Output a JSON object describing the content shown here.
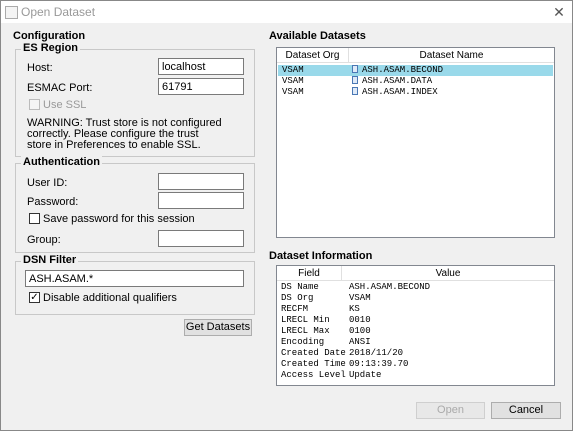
{
  "window": {
    "title": "Open Dataset",
    "close_symbol": "✕"
  },
  "configuration": {
    "title": "Configuration",
    "es_region": {
      "legend": "ES Region",
      "host_label": "Host:",
      "host_value": "localhost",
      "port_label": "ESMAC Port:",
      "port_value": "61791",
      "use_ssl_label": "Use SSL",
      "warning_line1": "WARNING: Trust store is not configured",
      "warning_line2": "correctly. Please configure the trust",
      "warning_line3": "store in Preferences to enable SSL."
    },
    "authentication": {
      "legend": "Authentication",
      "user_label": "User ID:",
      "password_label": "Password:",
      "save_password_label": "Save password for this session",
      "group_label": "Group:"
    },
    "dsn_filter": {
      "legend": "DSN Filter",
      "value": "ASH.ASAM.*",
      "disable_qualifiers_label": "Disable additional qualifiers",
      "disable_qualifiers_checked": "✓"
    },
    "get_datasets_label": "Get Datasets"
  },
  "available_datasets": {
    "title": "Available Datasets",
    "columns": [
      "Dataset Org",
      "Dataset Name"
    ],
    "rows": [
      {
        "org": "VSAM",
        "name": "ASH.ASAM.BECOND",
        "selected": true
      },
      {
        "org": "VSAM",
        "name": "ASH.ASAM.DATA",
        "selected": false
      },
      {
        "org": "VSAM",
        "name": "ASH.ASAM.INDEX",
        "selected": false
      }
    ]
  },
  "dataset_information": {
    "title": "Dataset Information",
    "columns": [
      "Field",
      "Value"
    ],
    "rows": [
      {
        "field": "DS Name",
        "value": "ASH.ASAM.BECOND"
      },
      {
        "field": "DS Org",
        "value": "VSAM"
      },
      {
        "field": "RECFM",
        "value": "KS"
      },
      {
        "field": "LRECL Min",
        "value": "0010"
      },
      {
        "field": "LRECL Max",
        "value": "0100"
      },
      {
        "field": "Encoding",
        "value": "ANSI"
      },
      {
        "field": "Created Date",
        "value": "2018/11/20"
      },
      {
        "field": "Created Time",
        "value": "09:13:39.70"
      },
      {
        "field": "Access Level",
        "value": "Update"
      }
    ]
  },
  "buttons": {
    "open_label": "Open",
    "cancel_label": "Cancel"
  },
  "colors": {
    "selection": "#99d9ea"
  }
}
